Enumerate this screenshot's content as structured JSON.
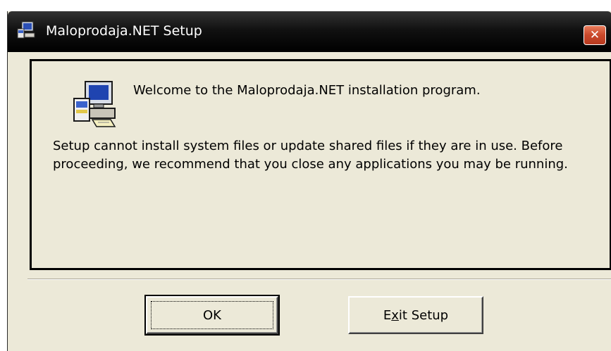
{
  "window": {
    "title": "Maloprodaja.NET Setup",
    "close_glyph": "✕",
    "icon": "setup-computer-icon"
  },
  "content": {
    "welcome": "Welcome to the Maloprodaja.NET installation program.",
    "warning": "Setup cannot install system files or update shared files if they are in use. Before proceeding, we recommend that you close any applications you may be running."
  },
  "buttons": {
    "ok_label": "OK",
    "exit_pre": "E",
    "exit_mnemonic": "x",
    "exit_post": "it Setup"
  },
  "colors": {
    "window_bg": "#ece9d8",
    "titlebar": "#000000",
    "close_button": "#c9482b"
  }
}
